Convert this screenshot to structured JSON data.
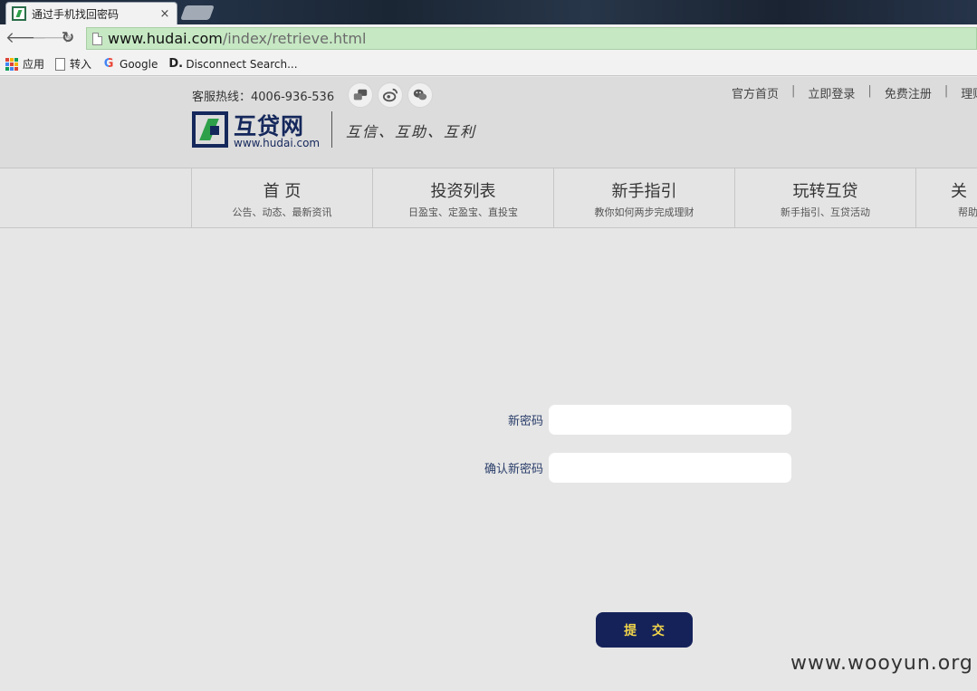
{
  "browser": {
    "tab_title": "通过手机找回密码",
    "tab_close": "×",
    "url_host": "www.hudai.com",
    "url_path": "/index/retrieve.html",
    "back_glyph": "🡐",
    "forward_glyph": "🡒",
    "reload_glyph": "↻",
    "bookmarks": [
      {
        "label": "应用",
        "icon": "apps-icon"
      },
      {
        "label": "转入",
        "icon": "document-icon"
      },
      {
        "label": "Google",
        "icon": "google-icon"
      },
      {
        "label": "Disconnect Search...",
        "icon": "disconnect-icon"
      }
    ]
  },
  "header": {
    "hotline": "客服热线：4006-936-536",
    "social_icons": [
      "chat-icon",
      "weibo-icon",
      "wechat-icon"
    ],
    "toplinks": [
      "官方首页",
      "立即登录",
      "免费注册",
      "理财"
    ],
    "separator": "|",
    "logo_cn": "互贷网",
    "logo_en": "www.hudai.com",
    "slogan": "互信、互助、互利"
  },
  "nav": [
    {
      "title": "首 页",
      "sub": "公告、动态、最新资讯"
    },
    {
      "title": "投资列表",
      "sub": "日盈宝、定盈宝、直投宝"
    },
    {
      "title": "新手指引",
      "sub": "教你如何两步完成理财"
    },
    {
      "title": "玩转互贷",
      "sub": "新手指引、互贷活动"
    },
    {
      "title": "关",
      "sub": "帮助"
    }
  ],
  "form": {
    "new_password_label": "新密码",
    "confirm_password_label": "确认新密码",
    "submit_label": "提 交"
  },
  "watermark": "www.wooyun.org",
  "colors": {
    "brand_navy": "#15225a",
    "brand_green": "#2ea04a",
    "submit_text": "#f2d54a",
    "omnibox_bg": "#c6e8c3"
  }
}
